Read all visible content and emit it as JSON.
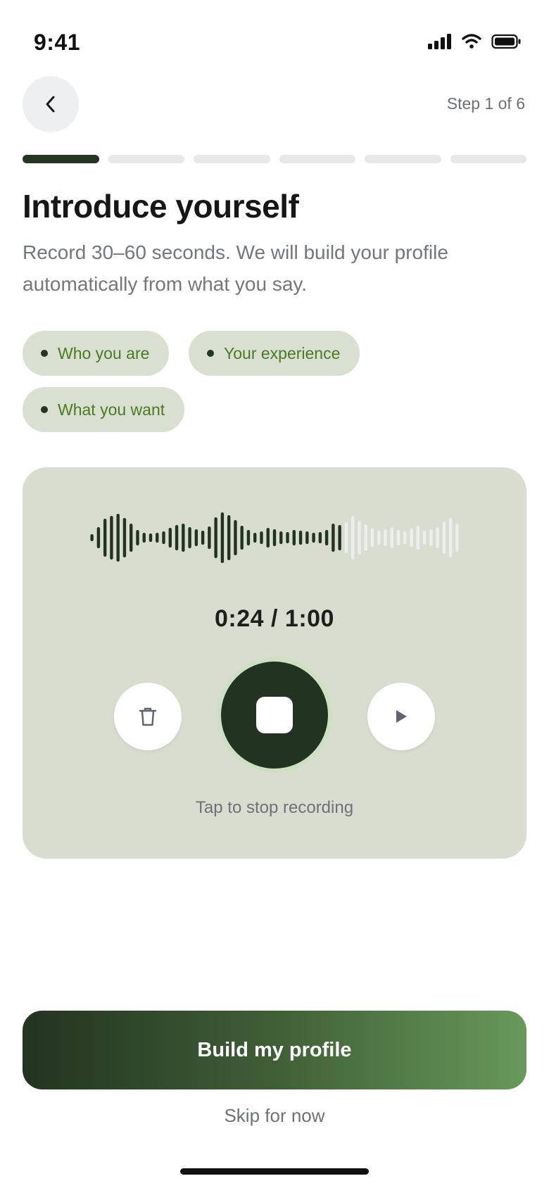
{
  "status_bar": {
    "time": "9:41",
    "icons": [
      "signal-icon",
      "wifi-icon",
      "battery-icon"
    ]
  },
  "header": {
    "back_icon": "chevron-left-icon",
    "step_label": "Step 1 of 6"
  },
  "progress": {
    "current_step": 1,
    "total_steps": 6
  },
  "title": "Introduce yourself",
  "subtitle": "Record 30–60 seconds. We will build your profile automatically from what you say.",
  "chips": [
    {
      "label": "Who you are"
    },
    {
      "label": "Your experience"
    },
    {
      "label": "What you want"
    }
  ],
  "recorder": {
    "timer": "0:24 / 1:00",
    "elapsed_seconds": 24,
    "total_seconds": 60,
    "hint": "Tap to stop recording",
    "delete_icon": "trash-icon",
    "stop_icon": "stop-icon",
    "play_icon": "play-icon"
  },
  "cta": {
    "label": "Build my profile"
  },
  "skip_label": "Skip for now",
  "colors": {
    "accent_dark": "#223321",
    "accent_light": "#68995a",
    "chip_bg": "#d9dfd1",
    "chip_text": "#4a7a22",
    "card_bg": "#d8ddd0"
  }
}
